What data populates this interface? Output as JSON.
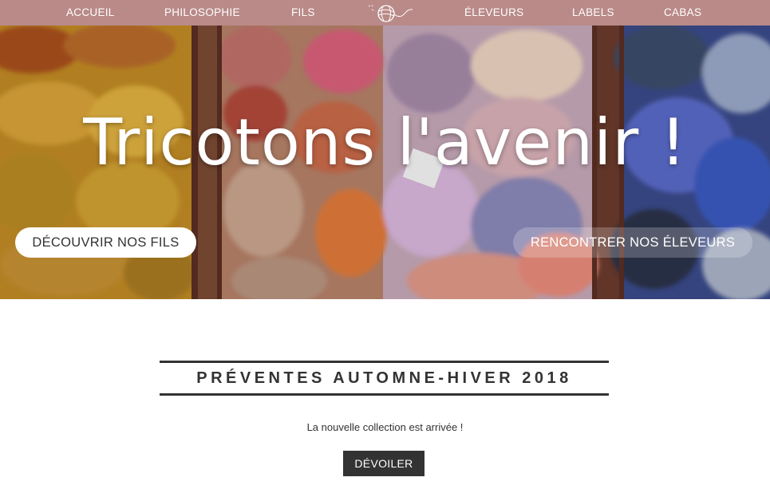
{
  "nav": {
    "items": [
      {
        "label": "ACCUEIL"
      },
      {
        "label": "PHILOSOPHIE"
      },
      {
        "label": "FILS"
      },
      {
        "label": "ÉLEVEURS"
      },
      {
        "label": "LABELS"
      },
      {
        "label": "CABAS"
      }
    ],
    "logo_icon": "yarn-ball-icon",
    "background": "#b98a88"
  },
  "hero": {
    "title": "Tricotons l'avenir !",
    "primary_button": "DÉCOUVRIR NOS FILS",
    "secondary_button": "RENCONTRER NOS ÉLEVEURS"
  },
  "presale": {
    "title": "PRÉVENTES AUTOMNE-HIVER 2018",
    "subtitle": "La nouvelle collection est arrivée !",
    "button": "DÉVOILER"
  }
}
